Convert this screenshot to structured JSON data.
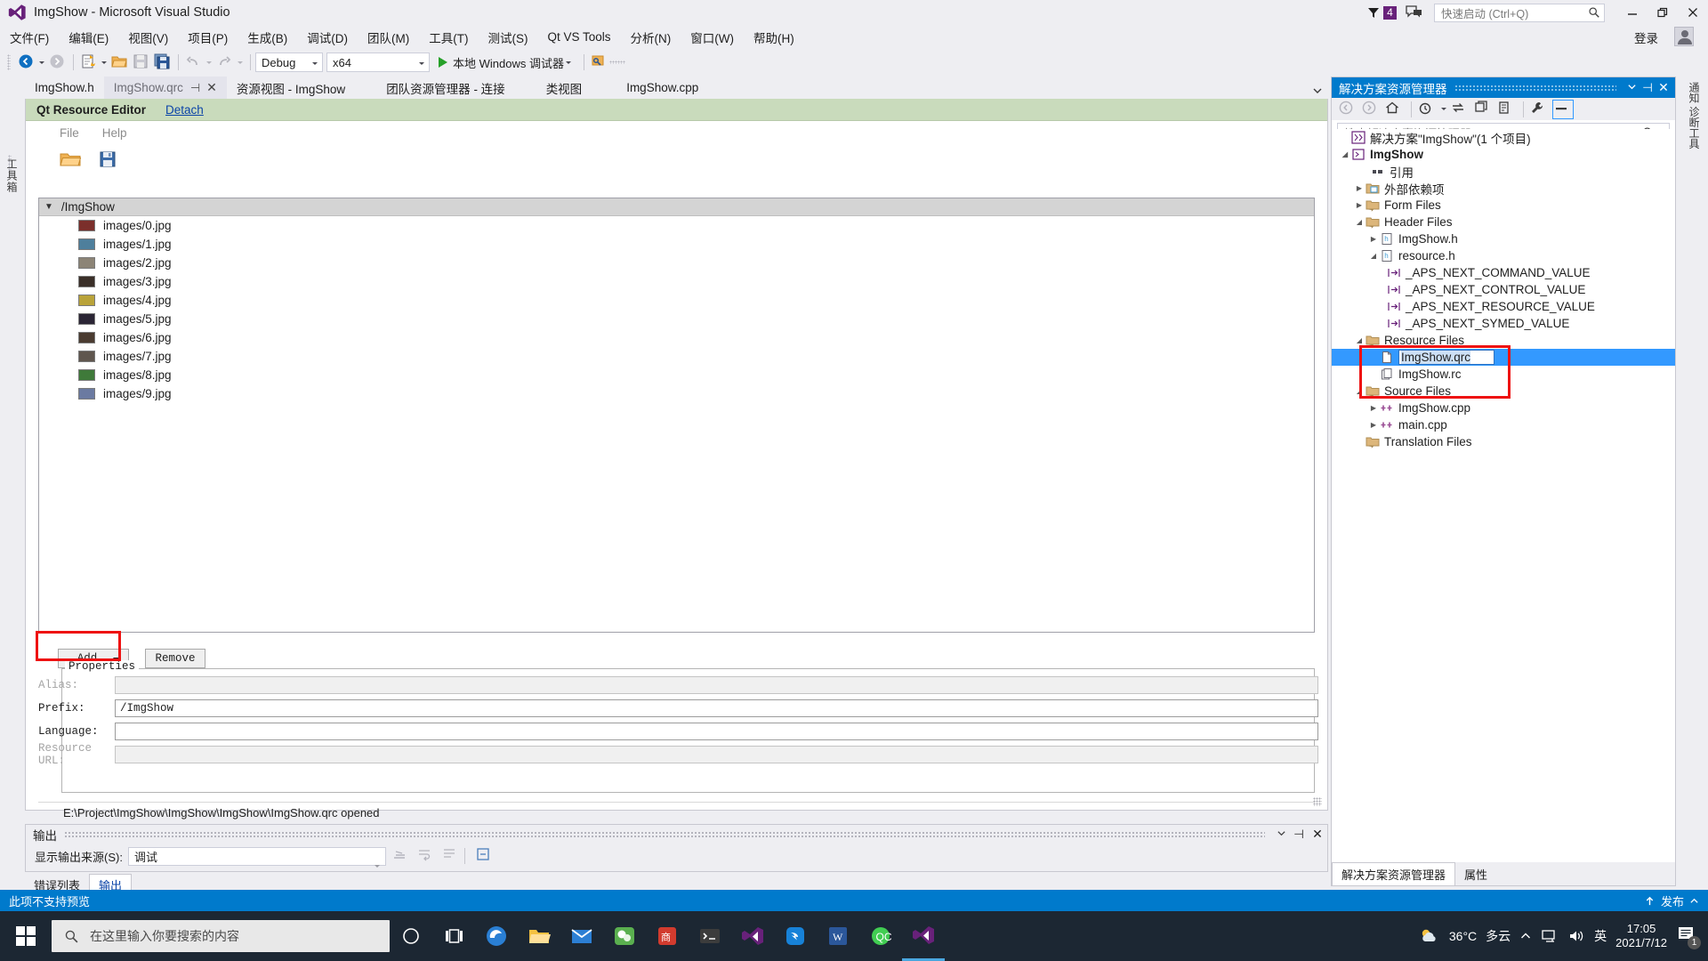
{
  "titlebar": {
    "app_title": "ImgShow - Microsoft Visual Studio",
    "notification_count": "4",
    "quick_launch_placeholder": "快速启动 (Ctrl+Q)",
    "minimize": "─",
    "restore": "❐",
    "close": "✕",
    "signin": "登录",
    "icons": {
      "vs_logo": "visual-studio-logo",
      "funnel": "funnel-icon",
      "feedback": "feedback-icon",
      "search": "search-icon",
      "account": "account-icon"
    }
  },
  "menubar": {
    "items": [
      {
        "label": "文件(F)"
      },
      {
        "label": "编辑(E)"
      },
      {
        "label": "视图(V)"
      },
      {
        "label": "项目(P)"
      },
      {
        "label": "生成(B)"
      },
      {
        "label": "调试(D)"
      },
      {
        "label": "团队(M)"
      },
      {
        "label": "工具(T)"
      },
      {
        "label": "测试(S)"
      },
      {
        "label": "Qt VS Tools"
      },
      {
        "label": "分析(N)"
      },
      {
        "label": "窗口(W)"
      },
      {
        "label": "帮助(H)"
      }
    ]
  },
  "toolbar": {
    "config_value": "Debug",
    "platform_value": "x64",
    "run_label": "本地 Windows 调试器",
    "icons": {
      "navigate_back": "navigate-back-icon",
      "navigate_forward": "navigate-forward-icon",
      "new_project": "new-project-icon",
      "open_file": "open-file-icon",
      "save": "save-icon",
      "save_all": "save-all-icon",
      "undo": "undo-icon",
      "redo": "redo-icon",
      "attach": "attach-to-process-icon"
    }
  },
  "document_tabs": [
    {
      "label": "ImgShow.h",
      "active": false
    },
    {
      "label": "ImgShow.qrc",
      "active": true,
      "pinned": true,
      "closable": true
    },
    {
      "label": "资源视图 - ImgShow",
      "active": false
    },
    {
      "label": "团队资源管理器 - 连接",
      "active": false
    },
    {
      "label": "类视图",
      "active": false
    },
    {
      "label": "ImgShow.cpp",
      "active": false
    }
  ],
  "left_vertical_tab": "工具箱",
  "right_vertical_tab": "通知  诊断工具",
  "editor": {
    "qt_header": {
      "title": "Qt Resource Editor",
      "detach_label": "Detach"
    },
    "menu": [
      {
        "label": "File"
      },
      {
        "label": "Help"
      }
    ],
    "toolbar_icons": {
      "open": "open-folder-icon",
      "save": "save-disk-icon"
    },
    "tree": {
      "root_label": "/ImgShow",
      "expanded": true,
      "files": [
        {
          "label": "images/0.jpg",
          "thumb": "#7b2f2b"
        },
        {
          "label": "images/1.jpg",
          "thumb": "#4e7f9c"
        },
        {
          "label": "images/2.jpg",
          "thumb": "#8c8476"
        },
        {
          "label": "images/3.jpg",
          "thumb": "#3a2f28"
        },
        {
          "label": "images/4.jpg",
          "thumb": "#b9a33a"
        },
        {
          "label": "images/5.jpg",
          "thumb": "#2b2535"
        },
        {
          "label": "images/6.jpg",
          "thumb": "#4a3b30"
        },
        {
          "label": "images/7.jpg",
          "thumb": "#5f564e"
        },
        {
          "label": "images/8.jpg",
          "thumb": "#3f7a3a"
        },
        {
          "label": "images/9.jpg",
          "thumb": "#6b7aa1"
        }
      ]
    },
    "buttons": {
      "add_label": "Add",
      "remove_label": "Remove"
    },
    "properties": {
      "group_label": "Properties",
      "rows": [
        {
          "label": "Alias:",
          "value": "",
          "enabled": false
        },
        {
          "label": "Prefix:",
          "value": "/ImgShow",
          "enabled": true
        },
        {
          "label": "Language:",
          "value": "",
          "enabled": true
        },
        {
          "label": "Resource URL:",
          "value": "",
          "enabled": false
        }
      ]
    },
    "status_text": "E:\\Project\\ImgShow\\ImgShow\\ImgShow\\ImgShow.qrc opened"
  },
  "output_pane": {
    "title": "输出",
    "source_label": "显示输出来源(S):",
    "source_value": "调试",
    "icons": {
      "pin": "pin-icon",
      "close": "close-icon",
      "chevron": "chevron-down-icon",
      "clear_all": "clear-all-icon",
      "toggle_wordwrap": "word-wrap-icon",
      "go_to": "go-to-icon"
    }
  },
  "bottom_tabs": [
    {
      "label": "错误列表",
      "active": false
    },
    {
      "label": "输出",
      "active": true
    }
  ],
  "solution_explorer": {
    "title": "解决方案资源管理器",
    "search_placeholder": "搜索解决方案资源管理器(Ctrl+;)",
    "toolbar_icons": [
      "navigate-back-icon",
      "navigate-forward-icon",
      "home-icon",
      "pending-changes-icon",
      "sync-with-active-document-icon",
      "refresh-icon",
      "show-all-files-icon",
      "properties-wrench-icon",
      "collapse-all-icon"
    ],
    "tree": [
      {
        "label": "解决方案\"ImgShow\"(1 个项目)",
        "depth": 0,
        "twisty": "",
        "icon": "solution-icon",
        "bold": false
      },
      {
        "label": "ImgShow",
        "depth": 1,
        "twisty": "expanded",
        "icon": "project-icon",
        "bold": true
      },
      {
        "label": "引用",
        "depth": 2,
        "twisty": "",
        "icon": "references-icon",
        "bold": false
      },
      {
        "label": "外部依赖项",
        "depth": 2,
        "twisty": "collapsed",
        "icon": "folder-dep-icon",
        "bold": false
      },
      {
        "label": "Form Files",
        "depth": 2,
        "twisty": "collapsed",
        "icon": "filter-folder-icon",
        "bold": false
      },
      {
        "label": "Header Files",
        "depth": 2,
        "twisty": "expanded",
        "icon": "filter-folder-icon",
        "bold": false
      },
      {
        "label": "ImgShow.h",
        "depth": 3,
        "twisty": "collapsed",
        "icon": "header-file-icon",
        "bold": false
      },
      {
        "label": "resource.h",
        "depth": 3,
        "twisty": "expanded",
        "icon": "header-file-icon",
        "bold": false
      },
      {
        "label": "_APS_NEXT_COMMAND_VALUE",
        "depth": 4,
        "twisty": "",
        "icon": "macro-icon",
        "bold": false
      },
      {
        "label": "_APS_NEXT_CONTROL_VALUE",
        "depth": 4,
        "twisty": "",
        "icon": "macro-icon",
        "bold": false
      },
      {
        "label": "_APS_NEXT_RESOURCE_VALUE",
        "depth": 4,
        "twisty": "",
        "icon": "macro-icon",
        "bold": false
      },
      {
        "label": "_APS_NEXT_SYMED_VALUE",
        "depth": 4,
        "twisty": "",
        "icon": "macro-icon",
        "bold": false
      },
      {
        "label": "Resource Files",
        "depth": 2,
        "twisty": "expanded",
        "icon": "filter-folder-icon",
        "bold": false
      },
      {
        "label": "ImgShow.qrc",
        "depth": 3,
        "twisty": "",
        "icon": "qrc-file-icon",
        "bold": false,
        "selected": true,
        "renaming": true
      },
      {
        "label": "ImgShow.rc",
        "depth": 3,
        "twisty": "",
        "icon": "rc-file-icon",
        "bold": false
      },
      {
        "label": "Source Files",
        "depth": 2,
        "twisty": "expanded",
        "icon": "filter-folder-icon",
        "bold": false
      },
      {
        "label": "ImgShow.cpp",
        "depth": 3,
        "twisty": "collapsed",
        "icon": "cpp-file-icon",
        "bold": false
      },
      {
        "label": "main.cpp",
        "depth": 3,
        "twisty": "collapsed",
        "icon": "cpp-file-icon",
        "bold": false
      },
      {
        "label": "Translation Files",
        "depth": 2,
        "twisty": "",
        "icon": "filter-folder-icon",
        "bold": false
      }
    ],
    "footer_tabs": [
      {
        "label": "解决方案资源管理器",
        "active": true
      },
      {
        "label": "属性",
        "active": false
      }
    ]
  },
  "vs_status_bar": {
    "message": "此项不支持预览",
    "publish_label": "发布",
    "upload_icon": "upload-arrow-icon",
    "chevron_icon": "chevron-up-icon"
  },
  "taskbar": {
    "search_placeholder": "在这里输入你要搜索的内容",
    "icons": [
      "start-icon",
      "search-icon",
      "cortana-icon",
      "task-view-icon"
    ],
    "apps": [
      {
        "name": "edge-icon",
        "color": "#2a7fd4"
      },
      {
        "name": "file-explorer-icon",
        "color": "#f5c141"
      },
      {
        "name": "mail-icon",
        "color": "#2c7fd4"
      },
      {
        "name": "wechat-dev-icon",
        "color": "#5aaf4f"
      },
      {
        "name": "app-red-icon",
        "color": "#d23b2e"
      },
      {
        "name": "terminal-icon",
        "color": "#3c3c3c"
      },
      {
        "name": "visual-studio-icon",
        "color": "#68217a"
      },
      {
        "name": "dingtalk-icon",
        "color": "#1782d8"
      },
      {
        "name": "word-icon",
        "color": "#2b579a"
      },
      {
        "name": "qt-creator-icon",
        "color": "#41cd52"
      },
      {
        "name": "visual-studio-active-icon",
        "color": "#68217a"
      }
    ],
    "tray": {
      "weather_temp": "36°C",
      "weather_desc": "多云",
      "weather_icon": "partly-cloudy-icon",
      "chevron_icon": "chevron-up-icon",
      "network_icon": "network-icon",
      "volume_icon": "volume-icon",
      "ime_label": "英",
      "time": "17:05",
      "date": "2021/7/12",
      "notification_count": "1",
      "notification_icon": "notification-icon"
    }
  },
  "annotations": {
    "color": "#ee1111",
    "boxes": [
      {
        "name": "add-button-highlight"
      },
      {
        "name": "qrc-file-highlight"
      }
    ]
  }
}
